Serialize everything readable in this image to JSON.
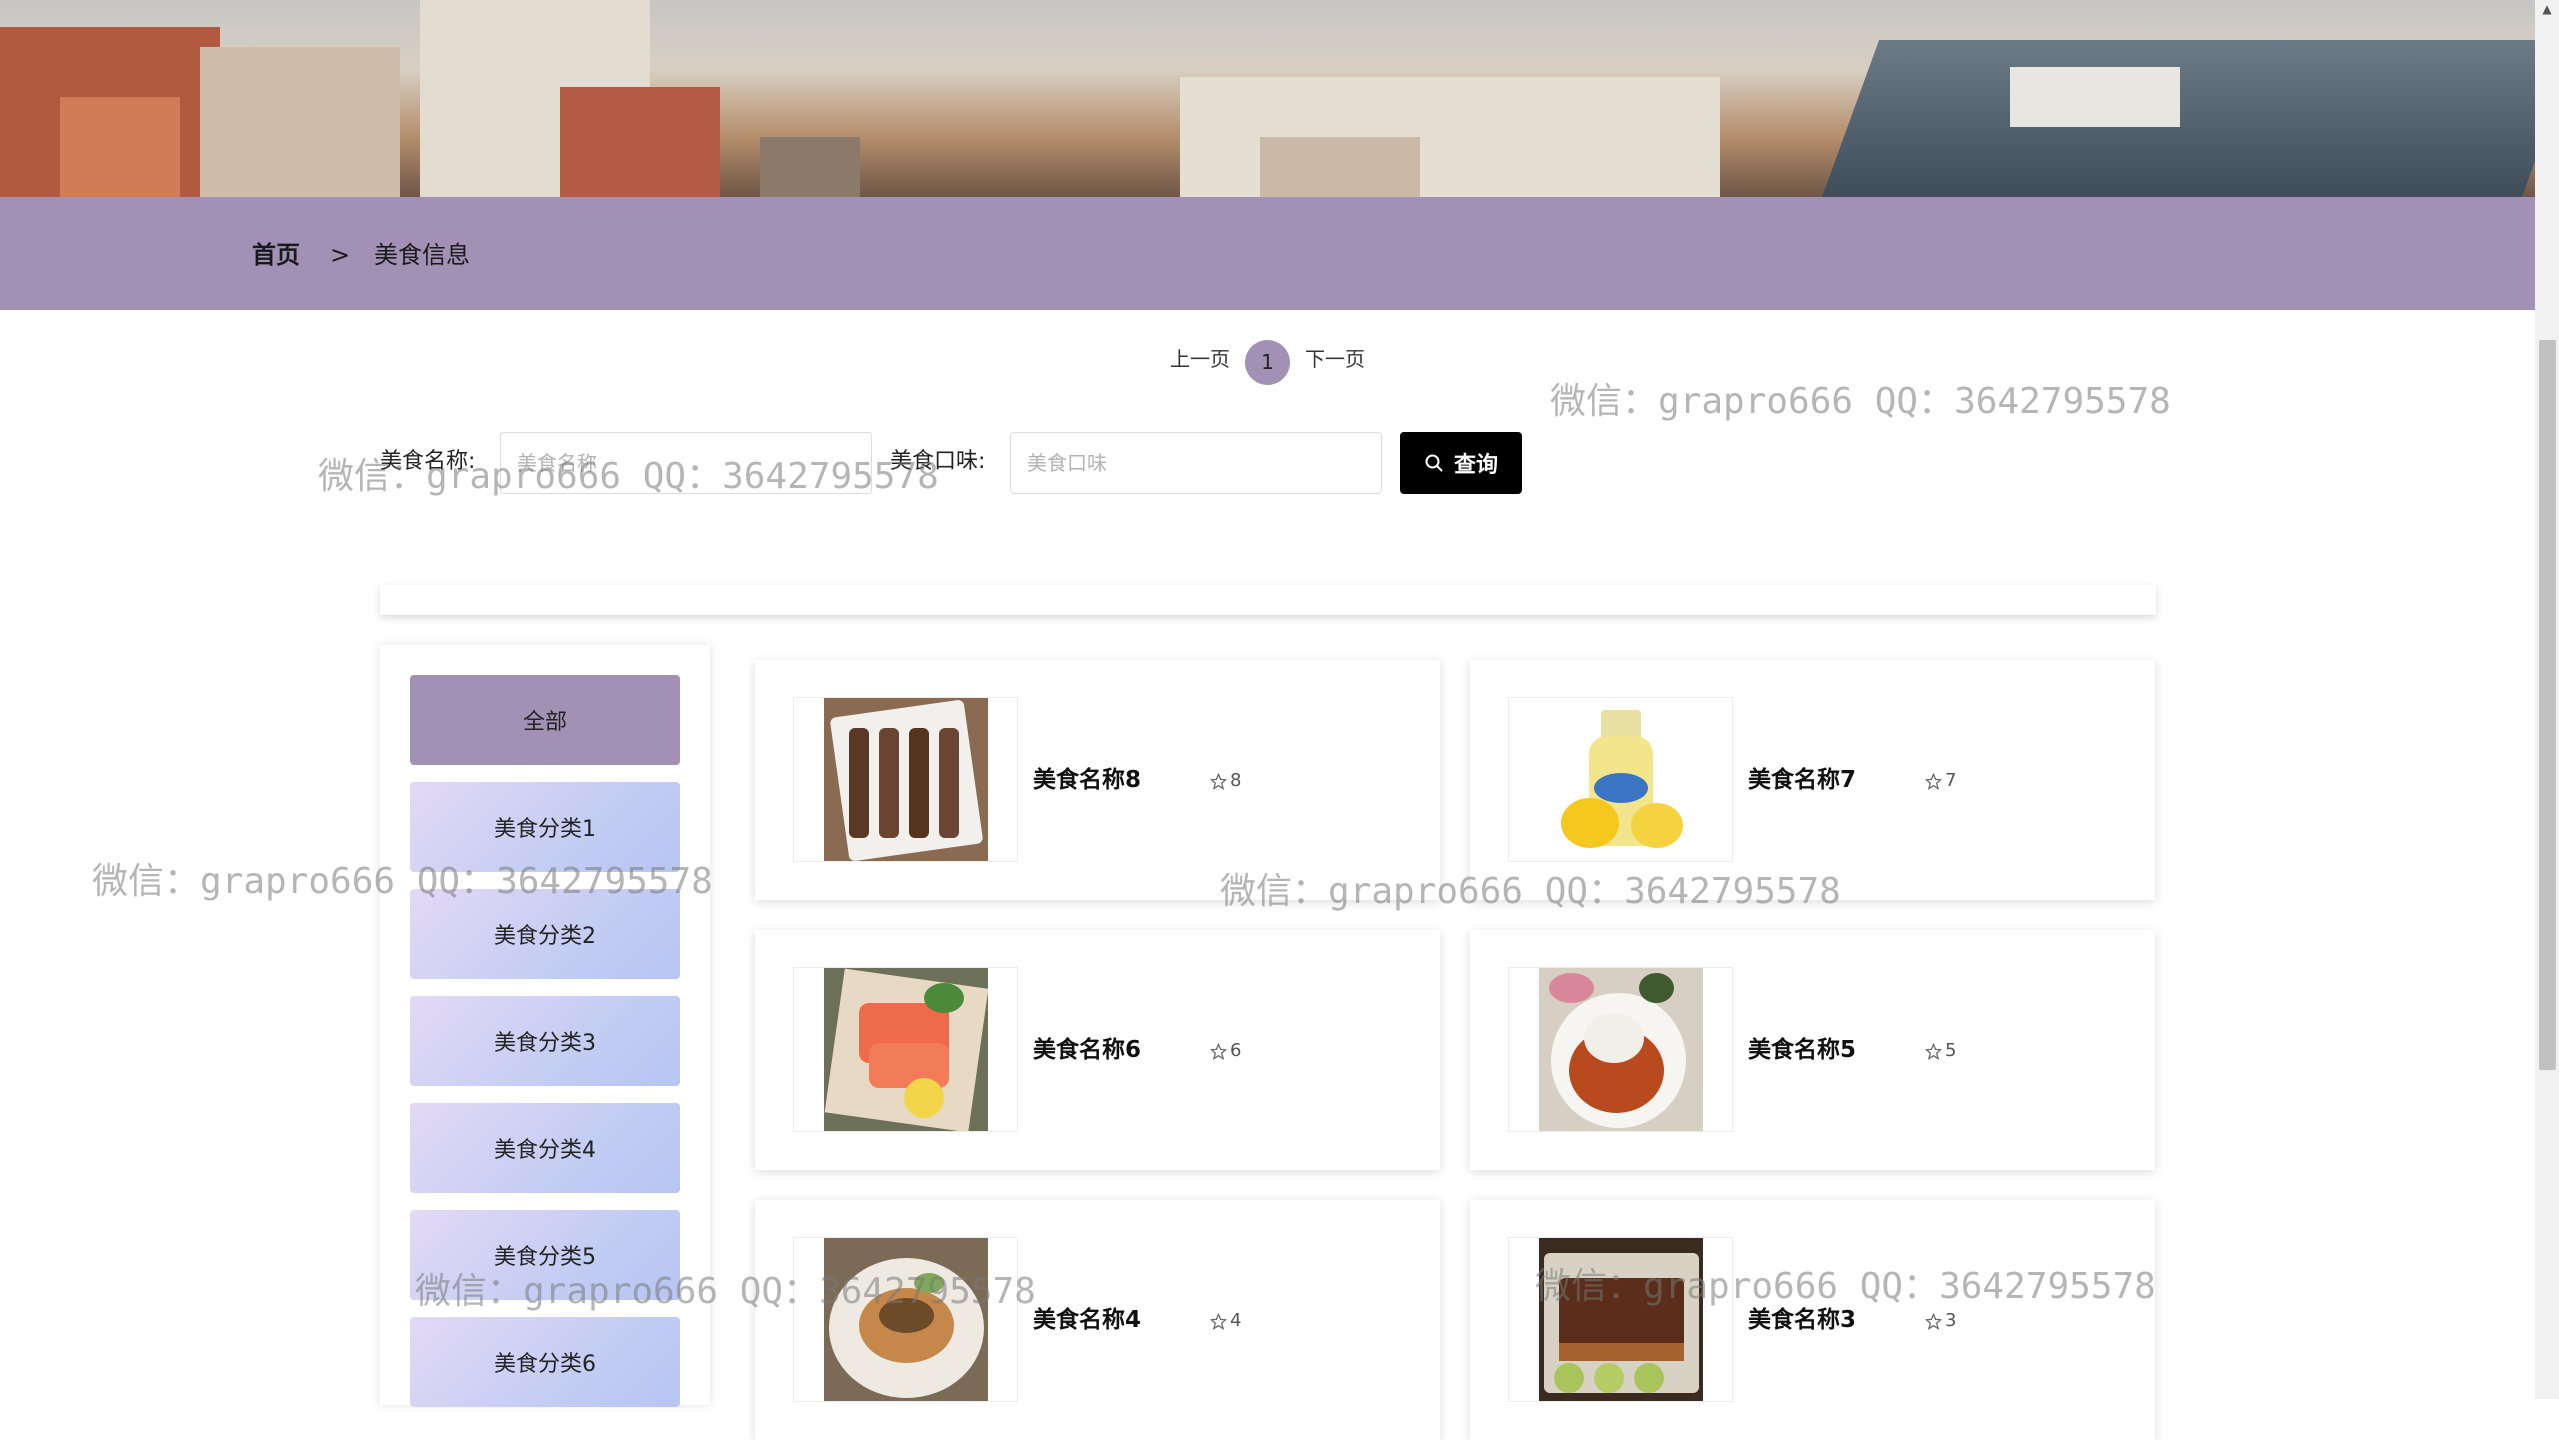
{
  "breadcrumb": {
    "home": "首页",
    "separator": ">",
    "current": "美食信息"
  },
  "pagination": {
    "prev": "上一页",
    "current_page": "1",
    "next": "下一页"
  },
  "search": {
    "name_label": "美食名称:",
    "name_placeholder": "美食名称",
    "flavor_label": "美食口味:",
    "flavor_placeholder": "美食口味",
    "button_label": "查询"
  },
  "categories": [
    {
      "label": "全部",
      "active": true
    },
    {
      "label": "美食分类1"
    },
    {
      "label": "美食分类2"
    },
    {
      "label": "美食分类3"
    },
    {
      "label": "美食分类4"
    },
    {
      "label": "美食分类5"
    },
    {
      "label": "美食分类6"
    }
  ],
  "products": [
    {
      "name": "美食名称8",
      "rating": "8",
      "image": "grilled-skewers"
    },
    {
      "name": "美食名称7",
      "rating": "7",
      "image": "lemon-drink-bottle"
    },
    {
      "name": "美食名称6",
      "rating": "6",
      "image": "salmon-sashimi"
    },
    {
      "name": "美食名称5",
      "rating": "5",
      "image": "rice-with-pork"
    },
    {
      "name": "美食名称4",
      "rating": "4",
      "image": "soup-bowl"
    },
    {
      "name": "美食名称3",
      "rating": "3",
      "image": "braised-pork"
    }
  ],
  "watermark": "微信：grapro666 QQ：3642795578",
  "colors": {
    "accent": "#a291b5",
    "button": "#000000",
    "category_gradient_start": "#e3d9f5",
    "category_gradient_end": "#b7c5f2"
  }
}
